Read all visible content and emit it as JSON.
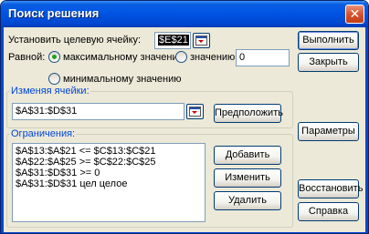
{
  "window": {
    "title": "Поиск решения",
    "close_glyph": "✕"
  },
  "target": {
    "label": "Установить целевую ячейку:",
    "value": "$E$21"
  },
  "equal": {
    "label": "Равной:",
    "max_label": "максимальному значению",
    "value_label": "значению:",
    "value_input": "0",
    "min_label": "минимальному значению",
    "selected": "max"
  },
  "changing": {
    "title": "Изменяя ячейки:",
    "value": "$A$31:$D$31",
    "guess_button": "Предположить"
  },
  "constraints": {
    "title": "Ограничения:",
    "items": [
      "$A$13:$A$21 <= $C$13:$C$21",
      "$A$22:$A$25 >= $C$22:$C$25",
      "$A$31:$D$31 >= 0",
      "$A$31:$D$31 цел целое"
    ],
    "add_button": "Добавить",
    "change_button": "Изменить",
    "delete_button": "Удалить"
  },
  "buttons": {
    "run": "Выполнить",
    "close": "Закрыть",
    "options": "Параметры",
    "reset": "Восстановить",
    "help": "Справка"
  },
  "colors": {
    "titlebar": "#0055e5",
    "group_title": "#0046d5",
    "face": "#ece9d8"
  },
  "icons": [
    "ref-collapse-icon",
    "close-icon"
  ]
}
